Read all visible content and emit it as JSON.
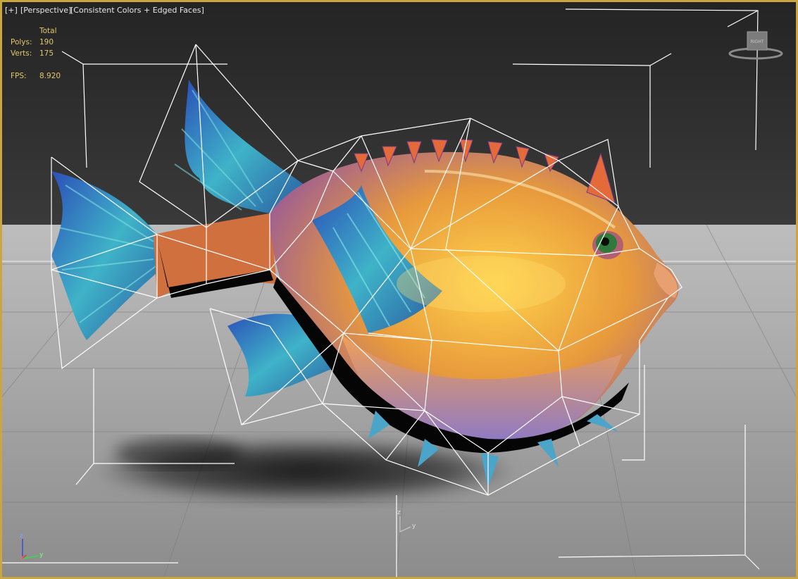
{
  "viewport": {
    "menu_plus": "[+]",
    "view_name": "[Perspective]",
    "shading_mode": "[Consistent Colors + Edged Faces]"
  },
  "stats": {
    "header": "Total",
    "polys_label": "Polys:",
    "polys_value": "190",
    "verts_label": "Verts:",
    "verts_value": "175",
    "fps_label": "FPS:",
    "fps_value": "8.920"
  },
  "viewcube": {
    "face_label": "RIGHT"
  },
  "axis_tripod": {
    "x": "x",
    "y": "y",
    "z": "z"
  },
  "gizmo": {
    "y": "y",
    "z": "z"
  },
  "colors": {
    "viewport_border": "#c9a640",
    "stats_text": "#e2c86a",
    "background": "#272727",
    "ground": "#9a9a9a",
    "wireframe": "#ffffff"
  }
}
